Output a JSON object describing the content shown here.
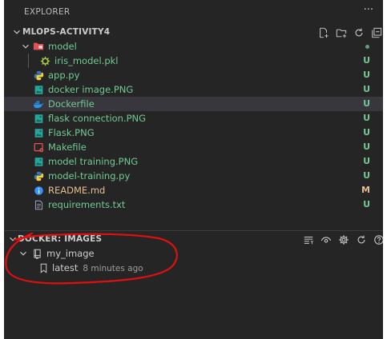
{
  "explorer": {
    "title": "EXPLORER",
    "more_actions": "···",
    "workspace": {
      "name": "MLOPS-ACTIVITY4",
      "actions": [
        "new-file-icon",
        "new-folder-icon",
        "refresh-icon",
        "collapse-all-icon"
      ]
    },
    "folder": {
      "name": "model",
      "icon": "folder-icon"
    },
    "nested_file": {
      "name": "iris_model.pkl",
      "icon": "gear-icon",
      "status": "U"
    },
    "files": [
      {
        "name": "app.py",
        "icon": "python-icon",
        "status": "U"
      },
      {
        "name": "docker image.PNG",
        "icon": "image-icon",
        "status": "U"
      },
      {
        "name": "Dockerfile",
        "icon": "docker-icon",
        "status": "U"
      },
      {
        "name": "flask connection.PNG",
        "icon": "image-icon",
        "status": "U"
      },
      {
        "name": "Flask.PNG",
        "icon": "image-icon",
        "status": "U"
      },
      {
        "name": "Makefile",
        "icon": "makefile-icon",
        "status": "U"
      },
      {
        "name": "model training.PNG",
        "icon": "image-icon",
        "status": "U"
      },
      {
        "name": "model-training.py",
        "icon": "python-icon",
        "status": "U"
      },
      {
        "name": "README.md",
        "icon": "info-icon",
        "status": "M"
      },
      {
        "name": "requirements.txt",
        "icon": "text-file-icon",
        "status": "U"
      }
    ]
  },
  "docker": {
    "title": "DOCKER: IMAGES",
    "actions": [
      "group-by-icon",
      "eye-icon",
      "gear-icon",
      "refresh-icon",
      "help-icon"
    ],
    "repository": {
      "name": "my_image",
      "icon": "repository-icon"
    },
    "tag": {
      "name": "latest",
      "time": "8 minutes ago",
      "icon": "tag-icon"
    }
  },
  "colors": {
    "sidebar_bg": "#252526",
    "untracked": "#73c991",
    "modified": "#e2c08d",
    "annotation": "#e01010"
  }
}
